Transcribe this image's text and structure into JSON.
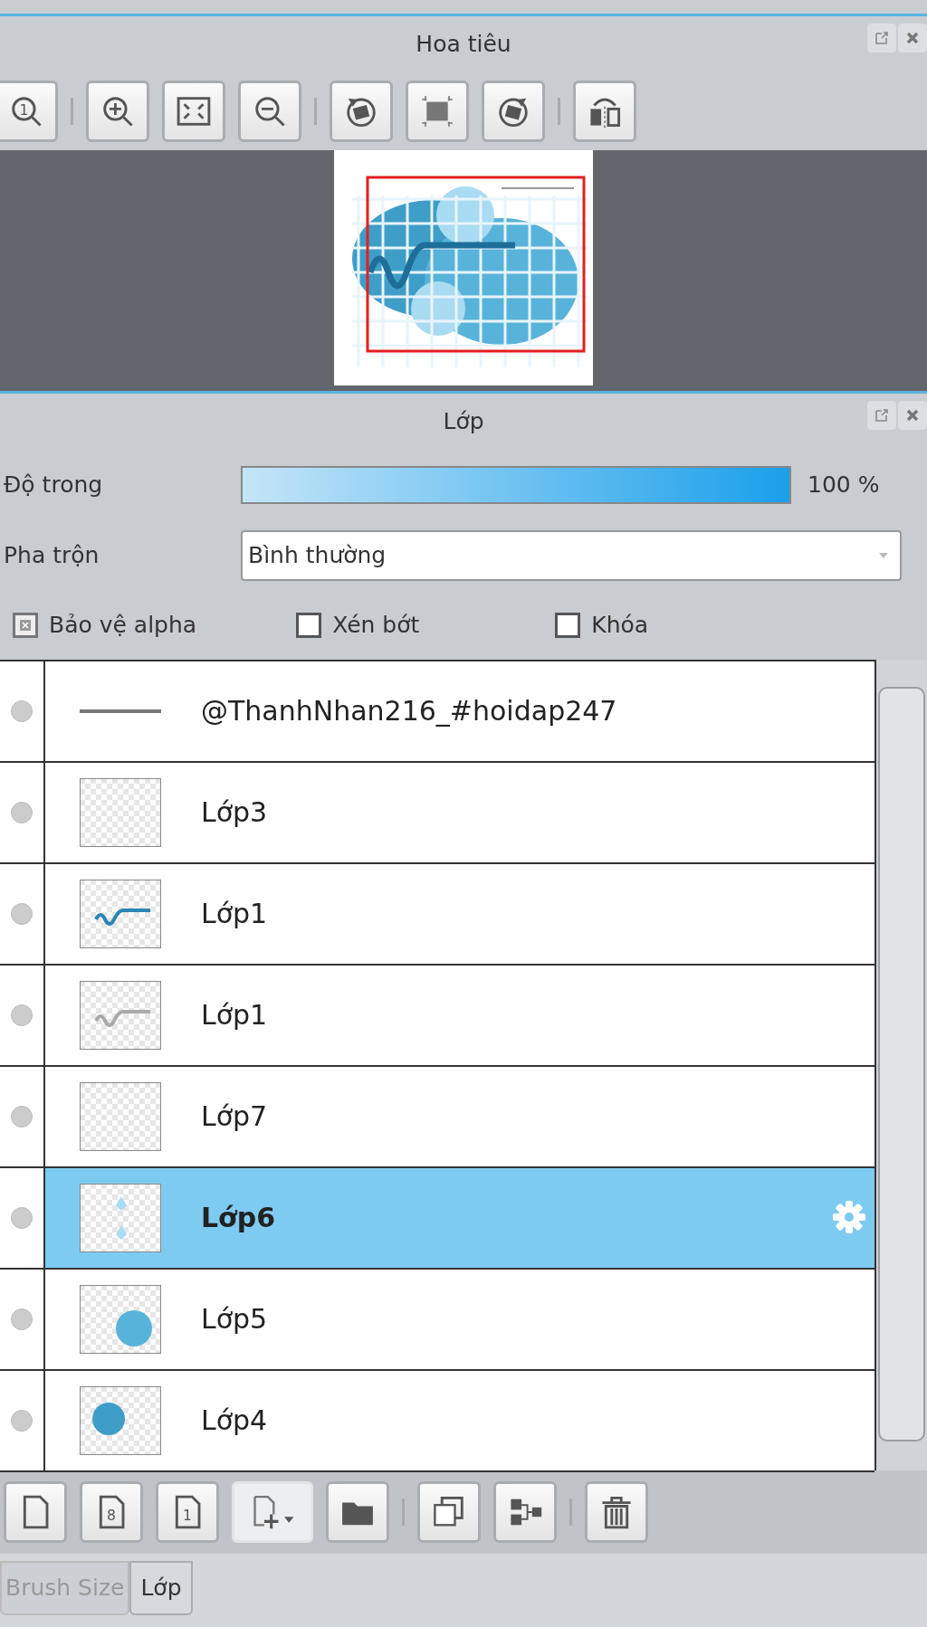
{
  "navigator": {
    "title": "Hoa tiêu",
    "toolbar": [
      {
        "kind": "zoom-actual",
        "glyph": "1"
      },
      {
        "kind": "separator"
      },
      {
        "kind": "zoom-in"
      },
      {
        "kind": "fit"
      },
      {
        "kind": "zoom-out"
      },
      {
        "kind": "separator"
      },
      {
        "kind": "rotate-left"
      },
      {
        "kind": "reset-rotation"
      },
      {
        "kind": "rotate-right"
      },
      {
        "kind": "separator"
      },
      {
        "kind": "flip"
      }
    ]
  },
  "layers_panel": {
    "title": "Lớp",
    "opacity": {
      "label": "Độ trong",
      "level": 1,
      "reading": "100 %"
    },
    "blend": {
      "label": "Pha trộn",
      "value": "Bình thường"
    },
    "options": [
      {
        "label": "Bảo vệ alpha",
        "checked": true
      },
      {
        "label": "Xén bớt",
        "checked": false
      },
      {
        "label": "Khóa",
        "checked": false
      }
    ],
    "layers": [
      {
        "name": "@ThanhNhan216_#hoidap247",
        "kind": "rule",
        "selected": false
      },
      {
        "name": "Lớp3",
        "kind": "blank",
        "selected": false
      },
      {
        "name": "Lớp1",
        "kind": "lettering",
        "selected": false
      },
      {
        "name": "Lớp1",
        "kind": "faded-lettering",
        "selected": false
      },
      {
        "name": "Lớp7",
        "kind": "blank",
        "selected": false
      },
      {
        "name": "Lớp6",
        "kind": "drops",
        "selected": true
      },
      {
        "name": "Lớp5",
        "kind": "circle-right",
        "selected": false
      },
      {
        "name": "Lớp4",
        "kind": "circle-left",
        "selected": false
      }
    ],
    "toolbar": [
      {
        "kind": "new-page"
      },
      {
        "kind": "numbered-page",
        "glyph": "8"
      },
      {
        "kind": "numbered-page",
        "glyph": "1"
      },
      {
        "kind": "add-menu"
      },
      {
        "kind": "folder"
      },
      {
        "kind": "separator"
      },
      {
        "kind": "duplicate"
      },
      {
        "kind": "merge"
      },
      {
        "kind": "separator"
      },
      {
        "kind": "trash"
      }
    ]
  },
  "tabs": [
    {
      "label": "Brush Size",
      "selected": false
    },
    {
      "label": "Lớp",
      "selected": true
    }
  ]
}
